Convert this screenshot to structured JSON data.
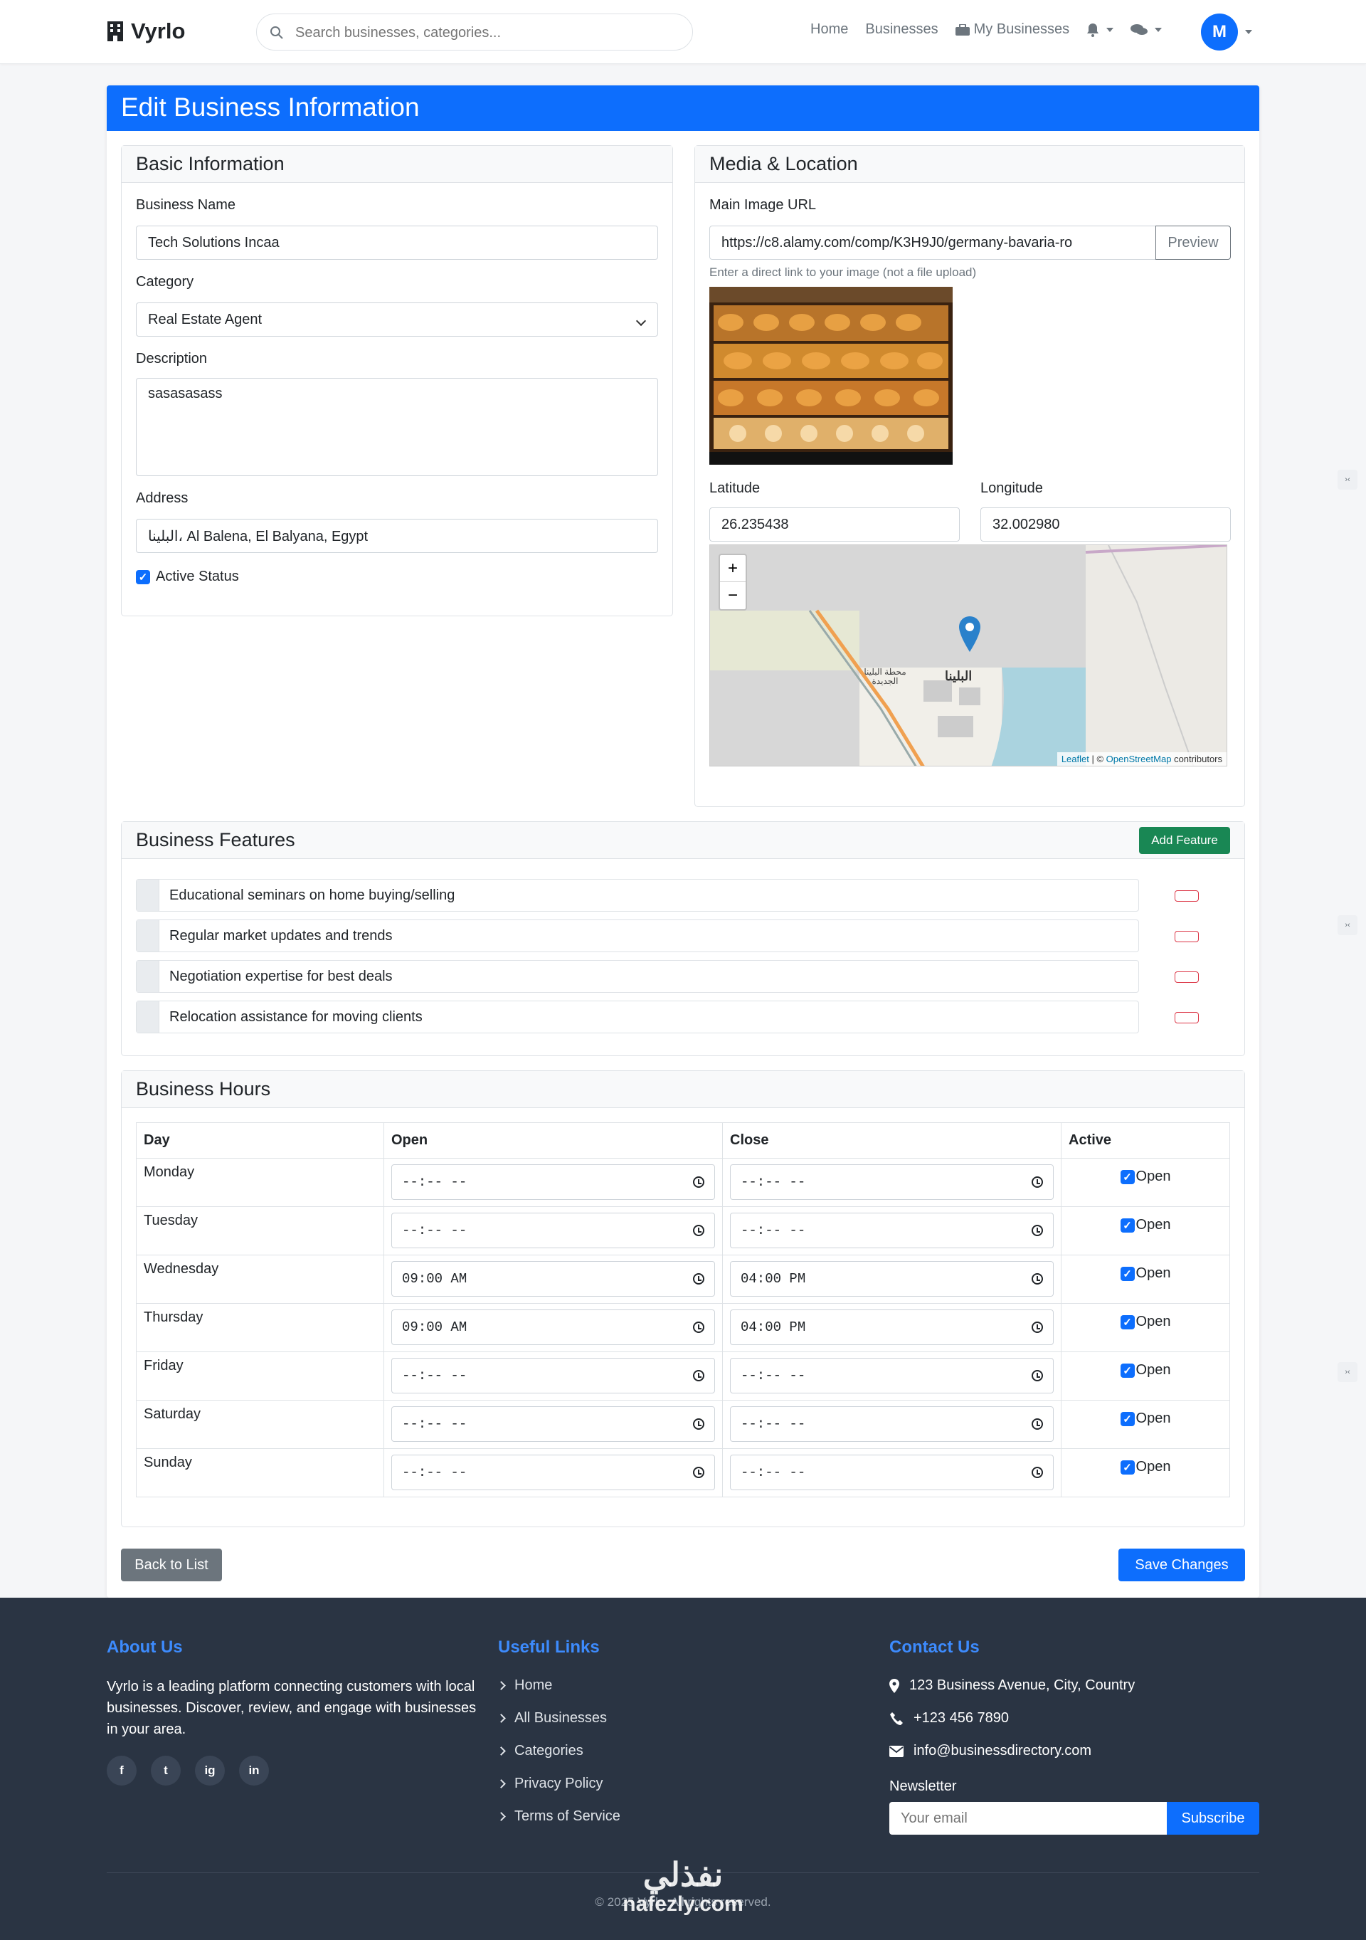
{
  "nav": {
    "brand": "Vyrlo",
    "search_placeholder": "Search businesses, categories...",
    "links": [
      "Home",
      "Businesses",
      "My Businesses"
    ],
    "avatar_letter": "M"
  },
  "page_title": "Edit Business Information",
  "basic": {
    "title": "Basic Information",
    "name_label": "Business Name",
    "name_value": "Tech Solutions Incaa",
    "category_label": "Category",
    "category_value": "Real Estate Agent",
    "description_label": "Description",
    "description_value": "sasasasass",
    "address_label": "Address",
    "address_value": "البلينا، Al Balena, El Balyana, Egypt",
    "active_label": "Active Status"
  },
  "media": {
    "title": "Media & Location",
    "image_label": "Main Image URL",
    "image_url": "https://c8.alamy.com/comp/K3H9J0/germany-bavaria-ro",
    "preview_label": "Preview",
    "image_hint": "Enter a direct link to your image (not a file upload)",
    "lat_label": "Latitude",
    "lat_value": "26.235438",
    "lng_label": "Longitude",
    "lng_value": "32.002980",
    "map_place": "البلينا",
    "map_station": "محطة البلينا الجديدة",
    "attribution_leaflet": "Leaflet",
    "attribution_osm": "OpenStreetMap",
    "attribution_rest": "contributors",
    "zoom_in": "+",
    "zoom_out": "−"
  },
  "features": {
    "title": "Business Features",
    "add_label": "Add Feature",
    "items": [
      "Educational seminars on home buying/selling",
      "Regular market updates and trends",
      "Negotiation expertise for best deals",
      "Relocation assistance for moving clients"
    ]
  },
  "hours": {
    "title": "Business Hours",
    "headers": [
      "Day",
      "Open",
      "Close",
      "Active"
    ],
    "rows": [
      {
        "day": "Monday",
        "open": "--:-- --",
        "close": "--:-- --",
        "active": "Open"
      },
      {
        "day": "Tuesday",
        "open": "--:-- --",
        "close": "--:-- --",
        "active": "Open"
      },
      {
        "day": "Wednesday",
        "open": "09:00 AM",
        "close": "04:00 PM",
        "active": "Open"
      },
      {
        "day": "Thursday",
        "open": "09:00 AM",
        "close": "04:00 PM",
        "active": "Open"
      },
      {
        "day": "Friday",
        "open": "--:-- --",
        "close": "--:-- --",
        "active": "Open"
      },
      {
        "day": "Saturday",
        "open": "--:-- --",
        "close": "--:-- --",
        "active": "Open"
      },
      {
        "day": "Sunday",
        "open": "--:-- --",
        "close": "--:-- --",
        "active": "Open"
      }
    ]
  },
  "actions": {
    "back": "Back to List",
    "save": "Save Changes"
  },
  "footer": {
    "about_title": "About Us",
    "about_text": "Vyrlo is a leading platform connecting customers with local businesses. Discover, review, and engage with businesses in your area.",
    "social": [
      "f",
      "t",
      "ig",
      "in"
    ],
    "links_title": "Useful Links",
    "links": [
      "Home",
      "All Businesses",
      "Categories",
      "Privacy Policy",
      "Terms of Service"
    ],
    "contact_title": "Contact Us",
    "address": "123 Business Avenue, City, Country",
    "phone": "+123 456 7890",
    "email": "info@businessdirectory.com",
    "newsletter_label": "Newsletter",
    "newsletter_placeholder": "Your email",
    "subscribe": "Subscribe",
    "copyright": "© 2025 Vyrlo. All rights reserved.",
    "watermark_ar": "نفذلي",
    "watermark_en": "nafezly.com"
  },
  "colors": {
    "primary": "#0d6efd",
    "success": "#198754",
    "danger": "#dc3545",
    "footer_bg": "#2a3443"
  }
}
